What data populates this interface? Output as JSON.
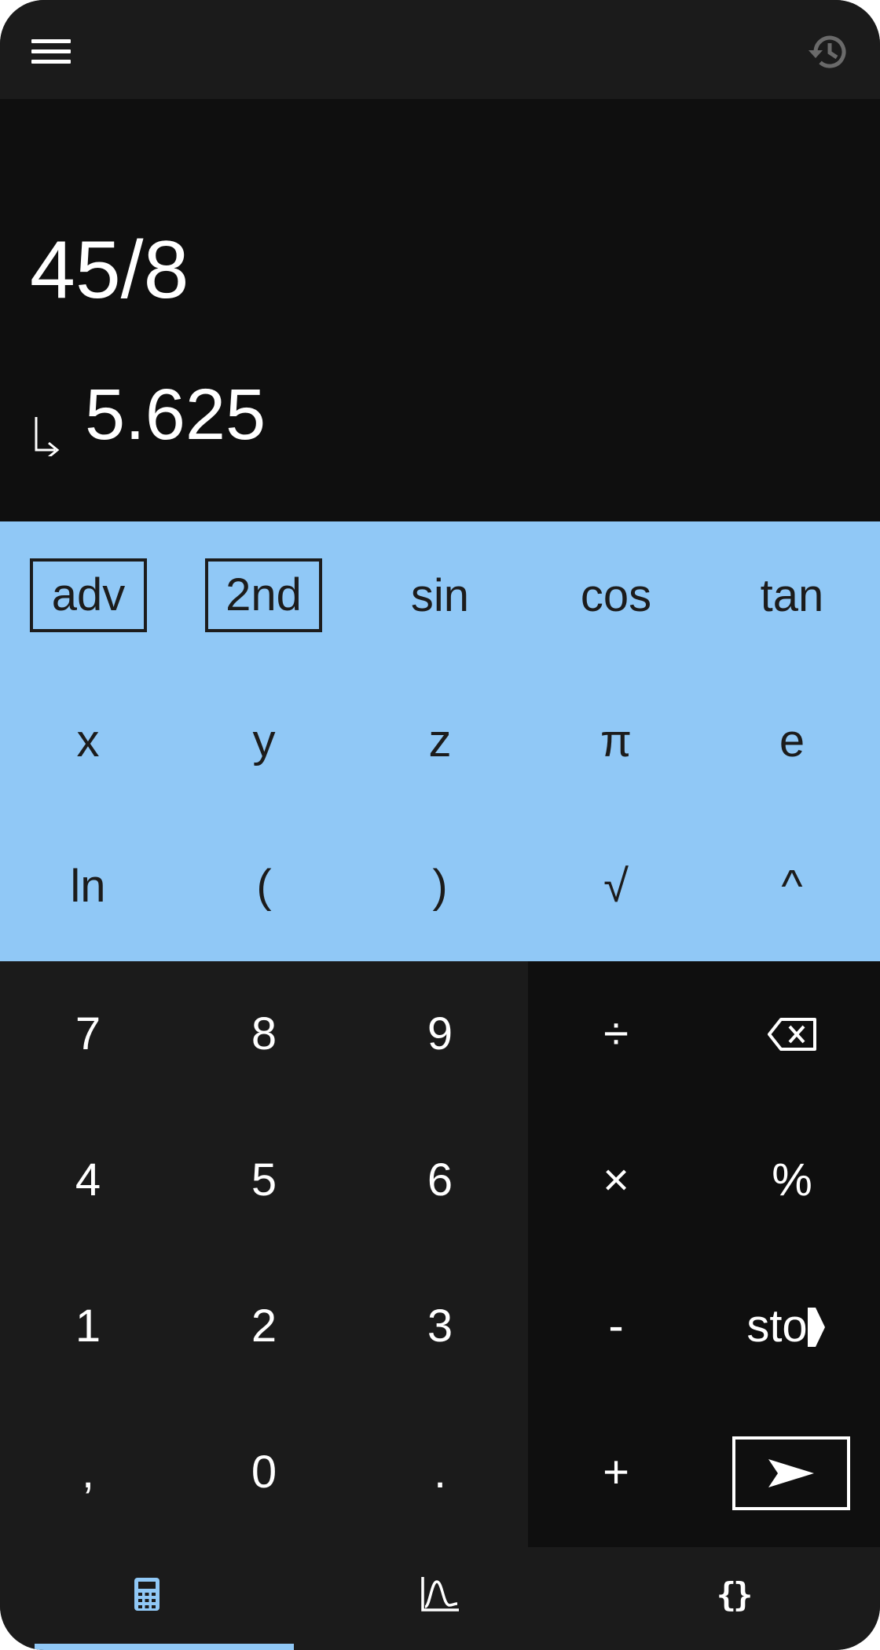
{
  "display": {
    "expression": "45/8",
    "result": "5.625"
  },
  "advanced_rows": [
    [
      "adv",
      "2nd",
      "sin",
      "cos",
      "tan"
    ],
    [
      "x",
      "y",
      "z",
      "π",
      "e"
    ],
    [
      "ln",
      "(",
      ")",
      "√",
      "^"
    ]
  ],
  "numpad": {
    "rows": [
      [
        "7",
        "8",
        "9"
      ],
      [
        "4",
        "5",
        "6"
      ],
      [
        "1",
        "2",
        "3"
      ],
      [
        ",",
        "0",
        "."
      ]
    ]
  },
  "operators": {
    "divide": "÷",
    "multiply": "×",
    "percent": "%",
    "subtract": "-",
    "store": "sto",
    "add": "+"
  },
  "icons": {
    "menu": "menu-icon",
    "history": "history-icon",
    "result_arrow": "result-arrow-icon",
    "backspace": "backspace-icon",
    "enter": "enter-arrow-icon",
    "nav_calculator": "calculator-icon",
    "nav_graph": "graph-icon",
    "nav_programming": "braces-icon"
  },
  "nav": {
    "programming_label": "{}"
  },
  "colors": {
    "accent": "#90c8f6",
    "background": "#1b1b1b",
    "display": "#0f0f0f",
    "operators": "#0f0f0f",
    "text_light": "#ffffff",
    "text_dark": "#1c1c1c"
  }
}
